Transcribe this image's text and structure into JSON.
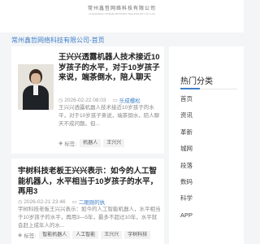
{
  "header": {
    "logo_cn": "常州鑫哲网络科技有限公司",
    "logo_en": "CHANGZHOU XINZHE NETWORK TECHNOLOGY CO.,LTD"
  },
  "breadcrumb": "常州鑫哲网络科技有限公司-首页",
  "articles": [
    {
      "title": "王兴兴透露机器人技术接近10岁孩子的水平，对于10岁孩子来说，端茶倒水，陪人聊天",
      "date": "2026-02-22 08:03",
      "category": "乐成樱松",
      "excerpt": "王兴兴透露机器人技术接近10岁孩子的水平，对于10岁孩子来说，端茶倒水，陪人聊天不成问题。但...",
      "tags_label": "标签:",
      "tags": [
        "机器人",
        "王兴兴"
      ]
    },
    {
      "title": "宇树科技老板王兴兴表示：如今的人工智能机器人，水平相当于10岁孩子的水平，再用3",
      "date": "2026-02-21 23:46",
      "category": "二眼刚的执",
      "excerpt": "宇树科技老板王兴兴表示：如今的人工智能机器人，水平相当于10岁孩子的水平，再用3—5年，最多不超过10年，水平就会赶上成年人的水...",
      "tags_label": "标签:",
      "tags": [
        "智能机器人",
        "人工智能",
        "王兴兴",
        "宇树科技"
      ]
    }
  ],
  "sidebar": {
    "title": "热门分类",
    "items": [
      "首页",
      "资讯",
      "革新",
      "城网",
      "段落",
      "数码",
      "科学",
      "APP"
    ]
  },
  "colors": {
    "accent": "#3f7fc9",
    "background": "#f4f5f7"
  }
}
